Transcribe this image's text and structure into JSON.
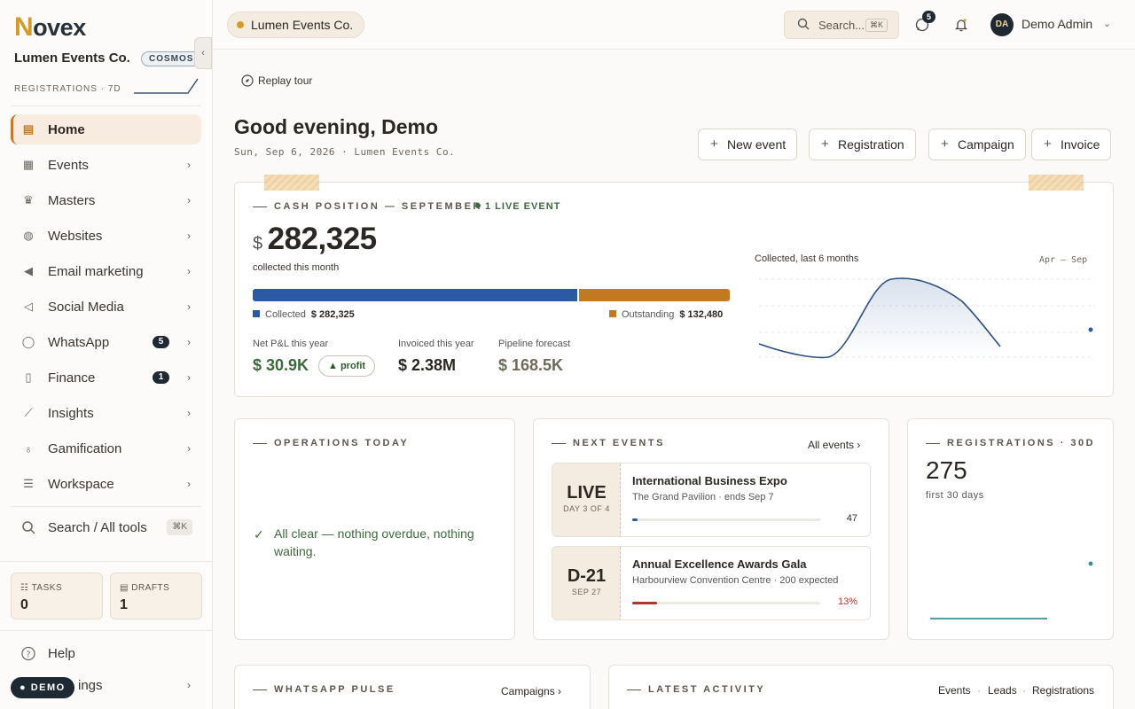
{
  "brand": {
    "logo_initial": "N",
    "logo_rest": "ovex"
  },
  "sidebar": {
    "org_name": "Lumen Events Co.",
    "org_badge": "COSMOS",
    "reg_label": "REGISTRATIONS · 7D",
    "items": [
      {
        "label": "Home",
        "icon": "home-icon",
        "active": true
      },
      {
        "label": "Events",
        "icon": "calendar-icon"
      },
      {
        "label": "Masters",
        "icon": "crown-icon"
      },
      {
        "label": "Websites",
        "icon": "globe-icon"
      },
      {
        "label": "Email marketing",
        "icon": "megaphone-icon"
      },
      {
        "label": "Social Media",
        "icon": "bullhorn-icon"
      },
      {
        "label": "WhatsApp",
        "icon": "whatsapp-icon",
        "count": "5"
      },
      {
        "label": "Finance",
        "icon": "document-icon",
        "count": "1"
      },
      {
        "label": "Insights",
        "icon": "chart-icon"
      },
      {
        "label": "Gamification",
        "icon": "trophy-icon"
      },
      {
        "label": "Workspace",
        "icon": "sliders-icon"
      }
    ],
    "search_label": "Search / All tools",
    "search_kbd": "⌘K",
    "tasks": {
      "label": "TASKS",
      "value": "0"
    },
    "drafts": {
      "label": "DRAFTS",
      "value": "1"
    },
    "help": "Help",
    "settings": "ings",
    "demo": "DEMO"
  },
  "topbar": {
    "org_chip": "Lumen Events Co.",
    "search_placeholder": "Search...",
    "search_kbd": "⌘K",
    "messages_badge": "5",
    "avatar_initials": "DA",
    "user_name": "Demo Admin"
  },
  "main": {
    "replay": "Replay tour",
    "greeting": "Good evening, Demo",
    "date_line": "Sun, Sep 6, 2026 · Lumen Events Co.",
    "quick_actions": [
      "New event",
      "Registration",
      "Campaign",
      "Invoice"
    ],
    "cash": {
      "title": "CASH POSITION — SEPTEMBER",
      "live": "1 LIVE EVENT",
      "currency": "$",
      "amount": "282,325",
      "sub": "collected this month",
      "collected_share": 0.68,
      "collected_label": "Collected",
      "collected_value": "$ 282,325",
      "outstanding_label": "Outstanding",
      "outstanding_value": "$ 132,480",
      "kpis": [
        {
          "label": "Net P&L this year",
          "value": "$ 30.9K",
          "color": "#3c6a3a"
        },
        {
          "label": "Invoiced this year",
          "value": "$ 2.38M",
          "color": "#2b2722"
        },
        {
          "label": "Pipeline forecast",
          "value": "$ 168.5K",
          "color": "#6f6a57"
        }
      ],
      "profit_pill": "▲ profit",
      "mini_chart_title": "Collected, last 6 months",
      "mini_chart_range": "Apr – Sep"
    },
    "operations": {
      "title": "OPERATIONS TODAY",
      "ok": "All clear — nothing overdue, nothing waiting."
    },
    "next_events": {
      "title": "NEXT EVENTS",
      "link": "All events",
      "items": [
        {
          "badge": "LIVE",
          "sub": "DAY 3 OF 4",
          "name": "International Business Expo",
          "meta": "The Grand Pavilion · ends Sep 7",
          "progress": 0.03,
          "count": "47",
          "color": "#2c5aa0"
        },
        {
          "badge": "D-21",
          "sub": "SEP 27",
          "name": "Annual Excellence Awards Gala",
          "meta": "Harbourview Convention Centre · 200 expected",
          "progress": 0.13,
          "count": "13%",
          "color": "#b0352a"
        }
      ]
    },
    "registrations": {
      "title": "REGISTRATIONS · 30D",
      "value": "275",
      "sub": "first 30 days"
    },
    "whatsapp": {
      "title": "WHATSAPP PULSE",
      "link": "Campaigns"
    },
    "activity": {
      "title": "LATEST ACTIVITY",
      "links": [
        "Events",
        "Leads",
        "Registrations"
      ]
    }
  }
}
